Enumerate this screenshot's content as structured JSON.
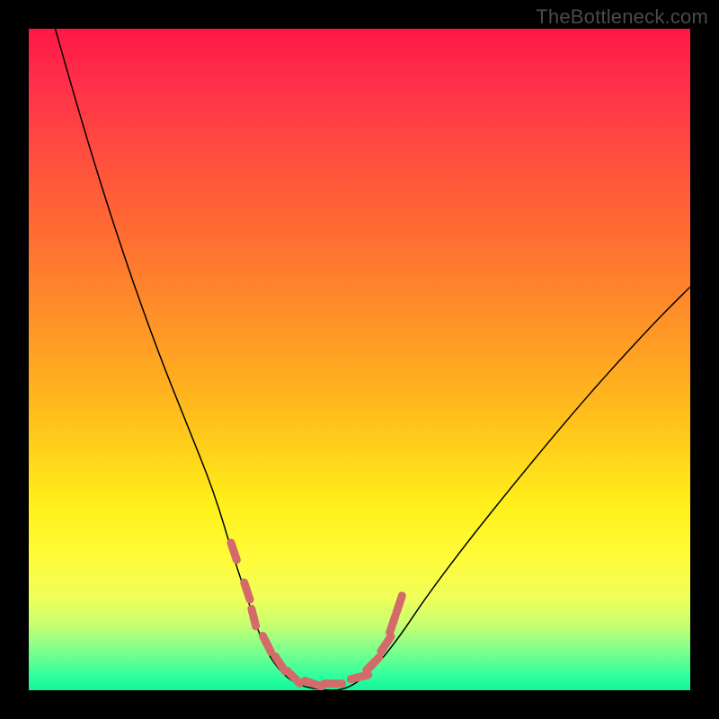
{
  "watermark": "TheBottleneck.com",
  "chart_data": {
    "type": "line",
    "title": "",
    "xlabel": "",
    "ylabel": "",
    "xlim": [
      0,
      100
    ],
    "ylim": [
      0,
      100
    ],
    "background_gradient": {
      "orientation": "vertical",
      "stops": [
        {
          "pos": 0,
          "color": "#ff1744"
        },
        {
          "pos": 20,
          "color": "#ff5a36"
        },
        {
          "pos": 42,
          "color": "#ff8c2a"
        },
        {
          "pos": 64,
          "color": "#ffd21a"
        },
        {
          "pos": 80,
          "color": "#fffc3a"
        },
        {
          "pos": 94,
          "color": "#7dff8d"
        },
        {
          "pos": 100,
          "color": "#12f59a"
        }
      ]
    },
    "series": [
      {
        "name": "bottleneck-curve",
        "color": "#000000",
        "stroke_width": 1.5,
        "x": [
          4,
          8,
          12,
          16,
          20,
          24,
          28,
          31,
          33,
          35,
          37,
          40,
          44,
          48,
          52,
          56,
          60,
          66,
          74,
          84,
          94,
          100
        ],
        "y": [
          100,
          86,
          73,
          61,
          50,
          40,
          30,
          20,
          14,
          8,
          4,
          1,
          0,
          0,
          3,
          8,
          14,
          22,
          32,
          44,
          55,
          61
        ]
      },
      {
        "name": "nadir-markers",
        "color": "#d46a6a",
        "stroke_width": 9,
        "style": "scatter-segments",
        "x": [
          31,
          33,
          34,
          36,
          38,
          40,
          43,
          46,
          50,
          52,
          54,
          55,
          56
        ],
        "y": [
          21,
          15,
          11,
          7,
          4,
          2,
          1,
          1,
          2,
          4,
          7,
          10,
          13
        ]
      }
    ]
  }
}
